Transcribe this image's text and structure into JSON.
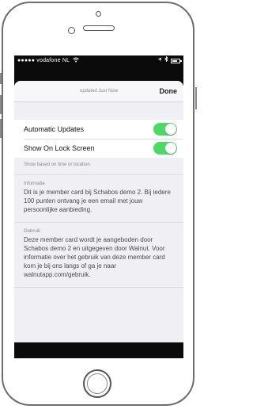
{
  "status_bar": {
    "carrier": "●●●●● vodafone NL",
    "wifi_icon": "wifi-icon",
    "battery_level": 0.8
  },
  "sheet": {
    "updated_text": "updated Just Now",
    "done_label": "Done"
  },
  "settings": {
    "items": [
      {
        "label": "Automatic Updates",
        "on": true
      },
      {
        "label": "Show On Lock Screen",
        "on": true
      }
    ],
    "footnote": "Show based on time or location.",
    "toggle_color": "#4cd964"
  },
  "info_section": {
    "title": "Informatie",
    "body": "Dit is je member card bij Schabos demo 2. Bij iedere 100 punten ontvang je een email met jouw persoonlijke aanbieding."
  },
  "usage_section": {
    "title": "Gebruik",
    "body": "Deze member card wordt je aangeboden door Schabos demo 2 en uitgegeven door Walnut. Voor informatie over het gebruik van deze member card kom je bij ons langs of ga je naar walnutapp.com/gebruik."
  }
}
